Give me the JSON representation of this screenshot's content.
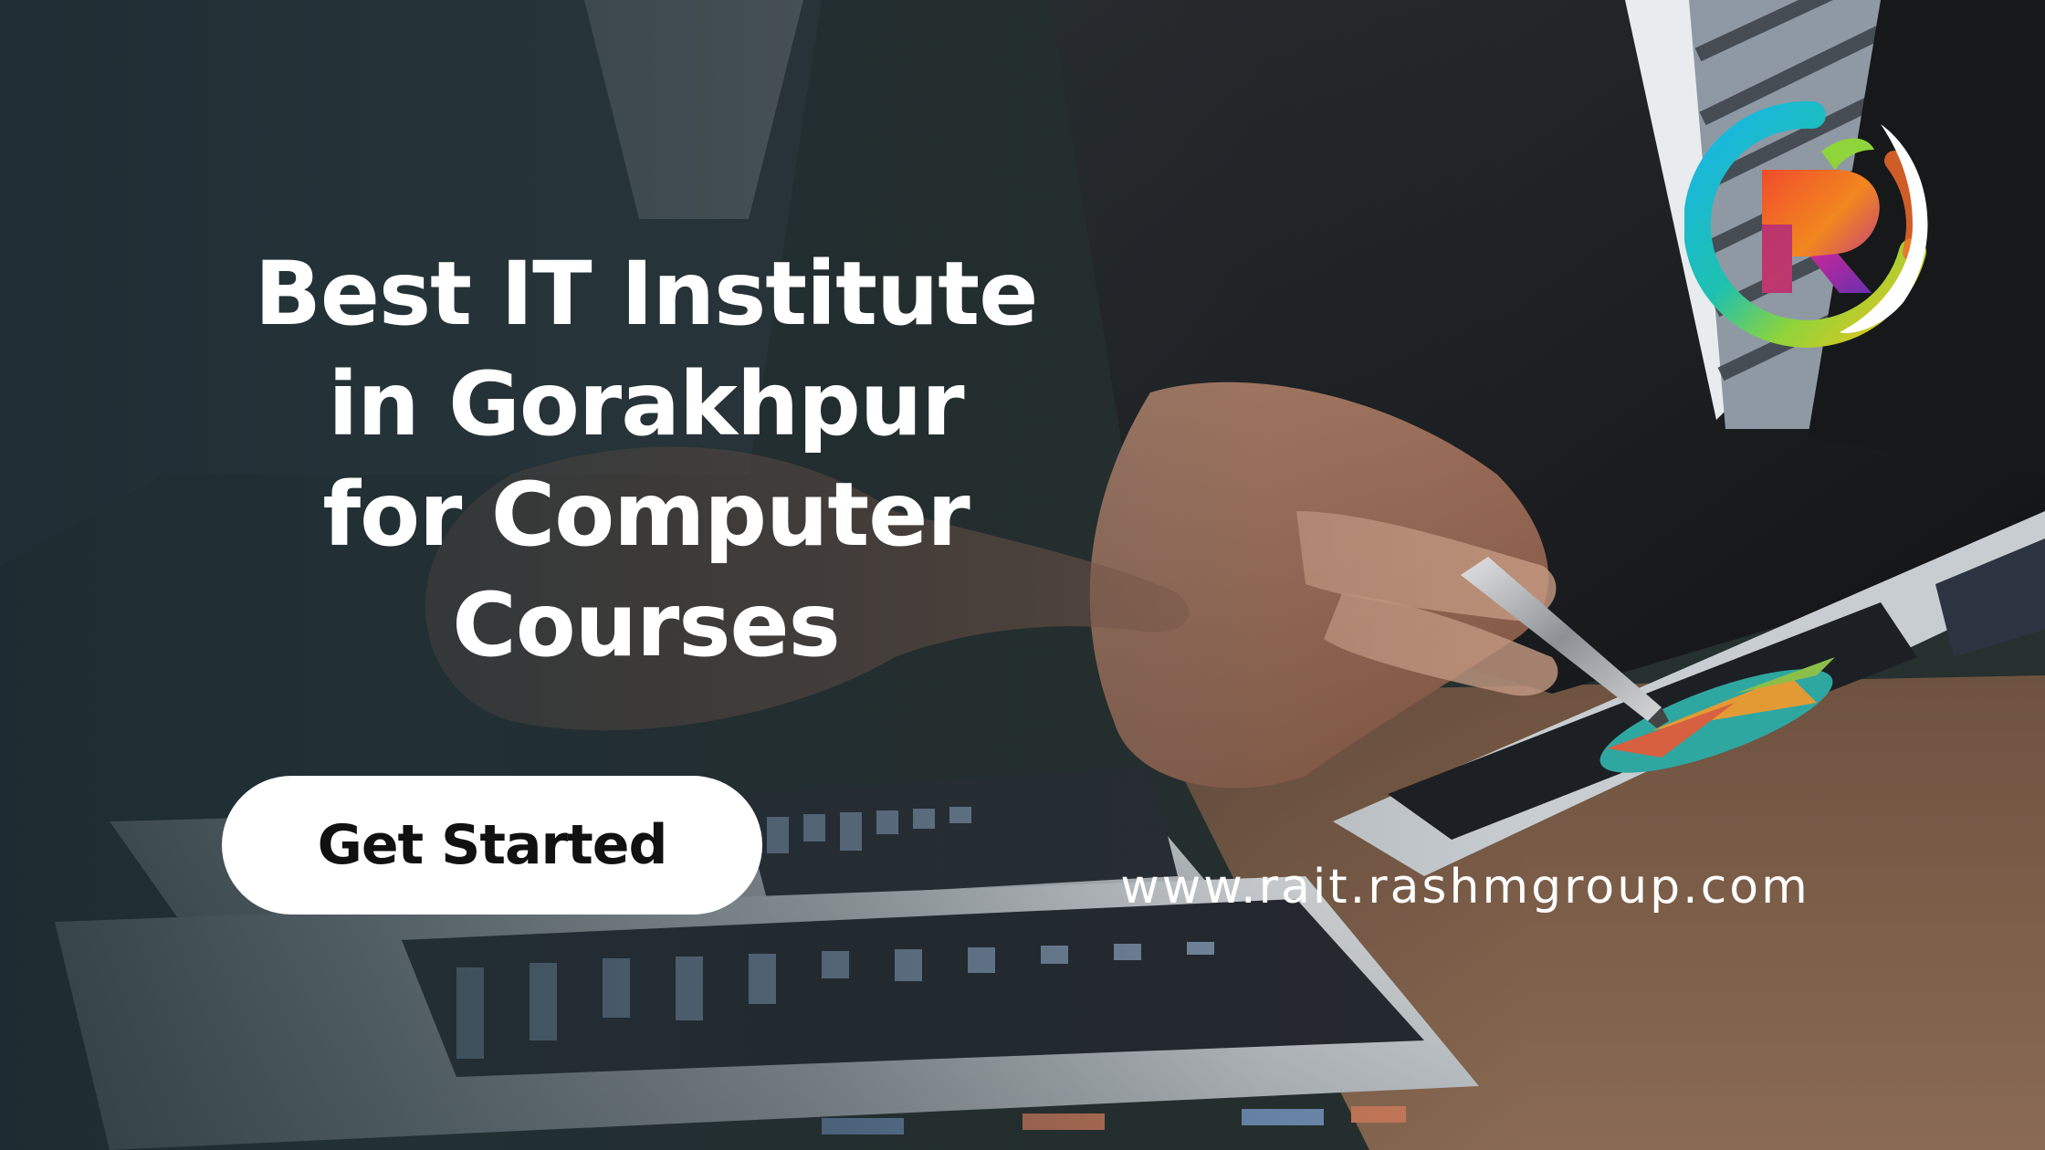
{
  "headline": {
    "line1": "Best IT Institute",
    "line2": "in Gorakhpur",
    "line3": "for Computer",
    "line4": "Courses"
  },
  "cta": {
    "label": "Get Started"
  },
  "website": {
    "url": "www.rait.rashmgroup.com"
  },
  "logo": {
    "letter": "R"
  },
  "colors": {
    "headline_text": "#ffffff",
    "button_bg": "#ffffff",
    "button_text": "#111111",
    "overlay": "#1c2c32"
  }
}
